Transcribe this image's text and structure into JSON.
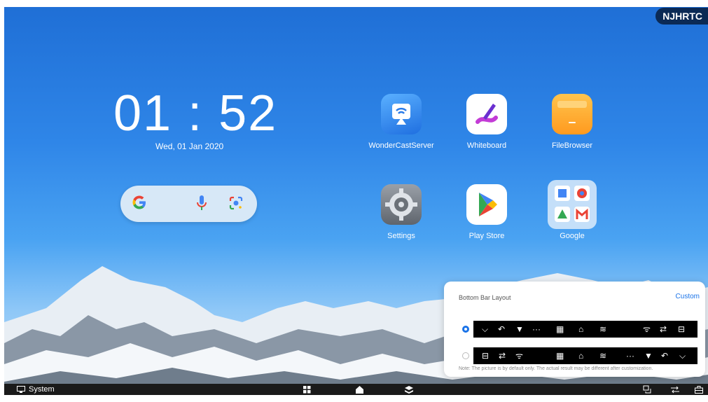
{
  "user_badge": "NJHRTC",
  "clock": {
    "time": "01 : 52",
    "date": "Wed, 01 Jan 2020"
  },
  "apps": [
    {
      "label": "WonderCastServer",
      "icon": "wondercast-icon"
    },
    {
      "label": "Whiteboard",
      "icon": "whiteboard-icon"
    },
    {
      "label": "FileBrowser",
      "icon": "folder-icon"
    },
    {
      "label": "Settings",
      "icon": "gear-icon"
    },
    {
      "label": "Play Store",
      "icon": "play-store-icon"
    },
    {
      "label": "Google",
      "icon": "google-folder-icon"
    }
  ],
  "bottom_bar": {
    "system_label": "System"
  },
  "layout_panel": {
    "title": "Bottom Bar Layout",
    "custom_label": "Custom",
    "option1": [
      "⌵",
      "↶",
      "▼",
      "···",
      "▦",
      "⌂",
      "≋",
      "ᯤ",
      "⇄",
      "⊟"
    ],
    "option2": [
      "⊟",
      "⇄",
      "ᯤ",
      "▦",
      "⌂",
      "≋",
      "···",
      "▼",
      "↶",
      "⌵"
    ],
    "note": "Note: The picture is by default only. The actual result may be different after customization."
  },
  "colors": {
    "accent": "#1a73e8",
    "bar": "#1a1a1a",
    "sky": "#2f86e8"
  }
}
